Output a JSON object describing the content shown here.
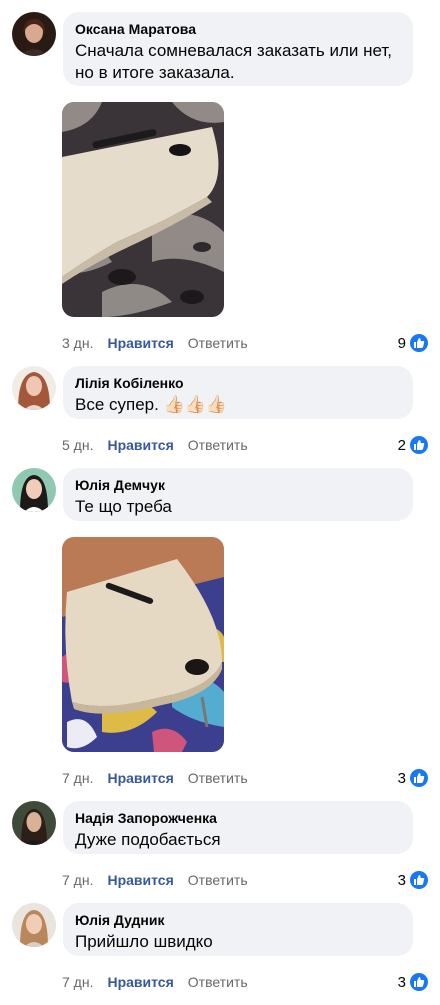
{
  "comments": [
    {
      "author": "Оксана Маратова",
      "text": "Сначала сомневалася заказать или нет, но в итоге заказала.",
      "time": "3 дн.",
      "like_label": "Нравится",
      "reply_label": "Ответить",
      "reactions": "9",
      "has_photo": true
    },
    {
      "author": "Лілія Кобіленко",
      "text": "Все супер. 👍🏻👍🏻👍🏻",
      "time": "5 дн.",
      "like_label": "Нравится",
      "reply_label": "Ответить",
      "reactions": "2",
      "has_photo": false
    },
    {
      "author": "Юлія Демчук",
      "text": "Те що треба",
      "time": "7 дн.",
      "like_label": "Нравится",
      "reply_label": "Ответить",
      "reactions": "3",
      "has_photo": true
    },
    {
      "author": "Надія Запорожченка",
      "text": "Дуже подобається",
      "time": "7 дн.",
      "like_label": "Нравится",
      "reply_label": "Ответить",
      "reactions": "3",
      "has_photo": false
    },
    {
      "author": "Юлія Дудник",
      "text": "Прийшло швидко",
      "time": "7 дн.",
      "like_label": "Нравится",
      "reply_label": "Ответить",
      "reactions": "3",
      "has_photo": false
    }
  ],
  "colors": {
    "bubble": "#f0f2f5",
    "like_link": "#385898",
    "meta": "#65676b",
    "reaction": "#1877f2"
  },
  "icons": {
    "reaction": "thumbs-up-icon"
  }
}
